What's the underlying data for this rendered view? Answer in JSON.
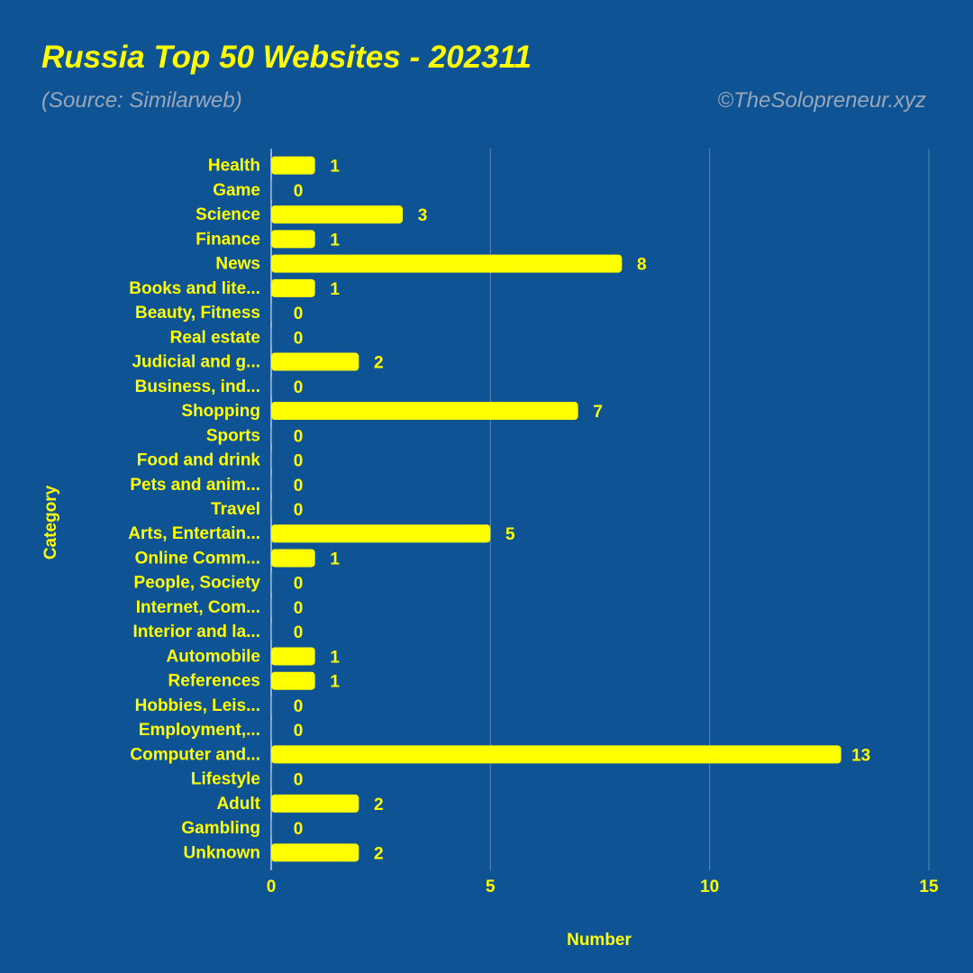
{
  "header": {
    "title": "Russia Top 50 Websites - 202311",
    "subtitle": "(Source: Similarweb)",
    "credit": "©TheSolopreneur.xyz"
  },
  "colors": {
    "background": "#0e5394",
    "bar": "#ffff00",
    "text": "#ffff00",
    "muted": "#9aa7b8",
    "grid": "#5d89b8"
  },
  "chart_data": {
    "type": "bar",
    "orientation": "horizontal",
    "title": "Russia Top 50 Websites - 202311",
    "subtitle": "(Source: Similarweb)",
    "xlabel": "Number",
    "ylabel": "Category",
    "xlim": [
      0,
      15
    ],
    "xticks": [
      0,
      5,
      10,
      15
    ],
    "grid": true,
    "categories": [
      "Health",
      "Game",
      "Science",
      "Finance",
      "News",
      "Books and lite...",
      "Beauty, Fitness",
      "Real estate",
      "Judicial and g...",
      "Business, ind...",
      "Shopping",
      "Sports",
      "Food and drink",
      "Pets and anim...",
      "Travel",
      "Arts, Entertain...",
      "Online Comm...",
      "People, Society",
      "Internet, Com...",
      "Interior and la...",
      "Automobile",
      "References",
      "Hobbies, Leis...",
      "Employment,...",
      "Computer and...",
      "Lifestyle",
      "Adult",
      "Gambling",
      "Unknown"
    ],
    "values": [
      1,
      0,
      3,
      1,
      8,
      1,
      0,
      0,
      2,
      0,
      7,
      0,
      0,
      0,
      0,
      5,
      1,
      0,
      0,
      0,
      1,
      1,
      0,
      0,
      13,
      0,
      2,
      0,
      2
    ]
  }
}
